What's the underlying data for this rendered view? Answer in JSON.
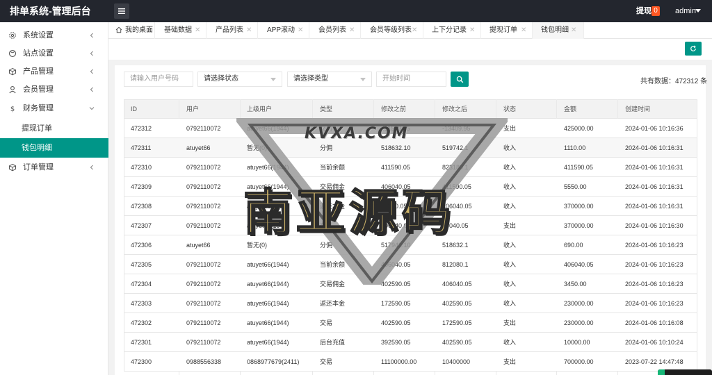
{
  "app": {
    "title": "排单系统-管理后台"
  },
  "header": {
    "menu_icon": "menu-icon",
    "withdraw_label": "提现",
    "withdraw_badge": "0",
    "user": "admin",
    "badge_color": "#ff5722"
  },
  "sidebar": {
    "accent": "#009688",
    "items": [
      {
        "label": "系统设置",
        "icon": "gear-icon",
        "expandable": true
      },
      {
        "label": "站点设置",
        "icon": "globe-icon",
        "expandable": true
      },
      {
        "label": "产品管理",
        "icon": "box-icon",
        "expandable": true
      },
      {
        "label": "会员管理",
        "icon": "user-icon",
        "expandable": true
      },
      {
        "label": "财务管理",
        "icon": "dollar-icon",
        "expanded": true
      },
      {
        "label": "订单管理",
        "icon": "box-icon",
        "expandable": true
      }
    ],
    "sub_items": [
      {
        "label": "提现订单",
        "active": false
      },
      {
        "label": "钱包明细",
        "active": true
      }
    ]
  },
  "tabs": [
    {
      "label": "我的桌面",
      "icon": "home-icon"
    },
    {
      "label": "基础数据"
    },
    {
      "label": "产品列表"
    },
    {
      "label": "APP滚动"
    },
    {
      "label": "会员列表"
    },
    {
      "label": "会员等级列表"
    },
    {
      "label": "上下分记录"
    },
    {
      "label": "提现订单"
    },
    {
      "label": "钱包明细",
      "active": true
    }
  ],
  "filters": {
    "user_placeholder": "请输入用户号码",
    "status_select": "请选择状态",
    "type_select": "请选择类型",
    "start_placeholder": "开始时间"
  },
  "total_text": "共有数据：472312 条",
  "table": {
    "headers": [
      "ID",
      "用户",
      "上级用户",
      "类型",
      "修改之前",
      "修改之后",
      "状态",
      "金额",
      "创建时间"
    ],
    "rows": [
      [
        "472312",
        "0792110072",
        "atuyet66(1944)",
        "交易",
        "411590.05",
        "-13409.95",
        "支出",
        "425000.00",
        "2024-01-06 10:16:36"
      ],
      [
        "472311",
        "atuyet66",
        "暂无(0)",
        "分佣",
        "518632.10",
        "519742.1",
        "收入",
        "1110.00",
        "2024-01-06 10:16:31"
      ],
      [
        "472310",
        "0792110072",
        "atuyet66(1944)",
        "当前余额",
        "411590.05",
        "823180.1",
        "收入",
        "411590.05",
        "2024-01-06 10:16:31"
      ],
      [
        "472309",
        "0792110072",
        "atuyet66(1944)",
        "交易佣金",
        "406040.05",
        "411590.05",
        "收入",
        "5550.00",
        "2024-01-06 10:16:31"
      ],
      [
        "472308",
        "0792110072",
        "atuyet66(1944)",
        "返还本金",
        "36040.05",
        "406040.05",
        "收入",
        "370000.00",
        "2024-01-06 10:16:31"
      ],
      [
        "472307",
        "0792110072",
        "atuyet66(1944)",
        "交易",
        "406040.05",
        "36040.05",
        "支出",
        "370000.00",
        "2024-01-06 10:16:30"
      ],
      [
        "472306",
        "atuyet66",
        "暂无(0)",
        "分佣",
        "517942.10",
        "518632.1",
        "收入",
        "690.00",
        "2024-01-06 10:16:23"
      ],
      [
        "472305",
        "0792110072",
        "atuyet66(1944)",
        "当前余额",
        "406040.05",
        "812080.1",
        "收入",
        "406040.05",
        "2024-01-06 10:16:23"
      ],
      [
        "472304",
        "0792110072",
        "atuyet66(1944)",
        "交易佣金",
        "402590.05",
        "406040.05",
        "收入",
        "3450.00",
        "2024-01-06 10:16:23"
      ],
      [
        "472303",
        "0792110072",
        "atuyet66(1944)",
        "返还本金",
        "172590.05",
        "402590.05",
        "收入",
        "230000.00",
        "2024-01-06 10:16:23"
      ],
      [
        "472302",
        "0792110072",
        "atuyet66(1944)",
        "交易",
        "402590.05",
        "172590.05",
        "支出",
        "230000.00",
        "2024-01-06 10:16:08"
      ],
      [
        "472301",
        "0792110072",
        "atuyet66(1944)",
        "后台充值",
        "392590.05",
        "402590.05",
        "收入",
        "10000.00",
        "2024-01-06 10:10:24"
      ],
      [
        "472300",
        "0988556338",
        "0868977679(2411)",
        "交易",
        "11100000.00",
        "10400000",
        "支出",
        "700000.00",
        "2023-07-22 14:47:48"
      ]
    ]
  },
  "watermark": {
    "en": "KVXA.COM",
    "cn": "南亚源码"
  }
}
